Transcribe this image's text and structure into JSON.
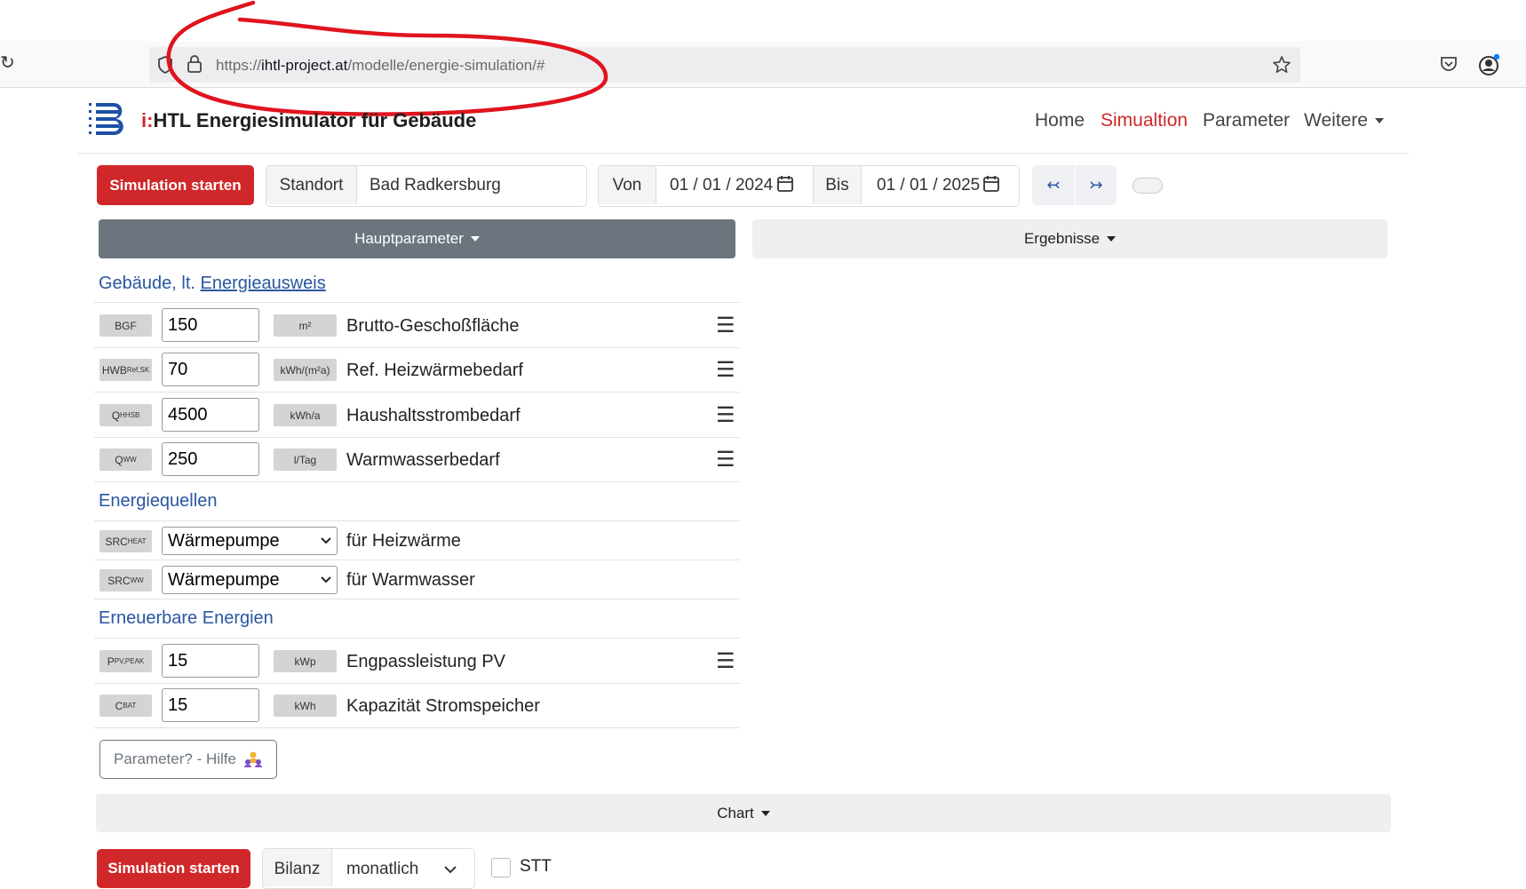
{
  "browser": {
    "url_scheme": "https://",
    "url_host": "ihtl-project.at",
    "url_path": "/modelle/energie-simulation/#"
  },
  "navbar": {
    "brand_prefix": "i:",
    "brand_title": "HTL Energiesimulator für Gebäude",
    "links": [
      "Home",
      "Simualtion",
      "Parameter",
      "Weitere"
    ],
    "active_color": "#d0282a"
  },
  "toolbar": {
    "start_label": "Simulation starten",
    "location_prefix": "Standort",
    "location_value": "Bad Radkersburg",
    "from_prefix": "Von",
    "from_value": "01 / 01 / 2024",
    "to_prefix": "Bis",
    "to_value": "01 / 01 / 2025",
    "prev_glyph": "↢",
    "next_glyph": "↣"
  },
  "tabs": {
    "main_params": "Hauptparameter",
    "results": "Ergebnisse"
  },
  "sections": {
    "building_prefix": "Gebäude, lt. ",
    "building_link": "Energieausweis",
    "sources": "Energiequellen",
    "renewables": "Erneuerbare Energien"
  },
  "building_rows": [
    {
      "sym": "BGF",
      "sub": "",
      "value": "150",
      "unit": "m²",
      "label": "Brutto-Geschoßfläche"
    },
    {
      "sym": "HWB",
      "sub": "Ref,SK",
      "value": "70",
      "unit": "kWh/(m²a)",
      "label": "Ref. Heizwärmebedarf"
    },
    {
      "sym": "Q",
      "sub": "HHSB",
      "value": "4500",
      "unit": "kWh/a",
      "label": "Haushaltsstrombedarf"
    },
    {
      "sym": "Q",
      "sub": "WW",
      "value": "250",
      "unit": "l/Tag",
      "label": "Warmwasserbedarf"
    }
  ],
  "source_rows": [
    {
      "sym": "SRC",
      "sub": "HEAT",
      "value": "Wärmepumpe",
      "label": "für Heizwärme"
    },
    {
      "sym": "SRC",
      "sub": "WW",
      "value": "Wärmepumpe",
      "label": "für Warmwasser"
    }
  ],
  "renewable_rows": [
    {
      "sym": "P",
      "sub": "PV,PEAK",
      "value": "15",
      "unit": "kWp",
      "label": "Engpassleistung PV"
    },
    {
      "sym": "C",
      "sub": "BAT",
      "value": "15",
      "unit": "kWh",
      "label": "Kapazität Stromspeicher"
    }
  ],
  "help_button": "Parameter? - Hilfe",
  "chart_tab": "Chart",
  "bottom": {
    "start_label": "Simulation starten",
    "balance_prefix": "Bilanz",
    "balance_value": "monatlich",
    "stt_label": "STT"
  },
  "icons": {
    "menu": "☰",
    "annotation_color": "#e0141e"
  }
}
